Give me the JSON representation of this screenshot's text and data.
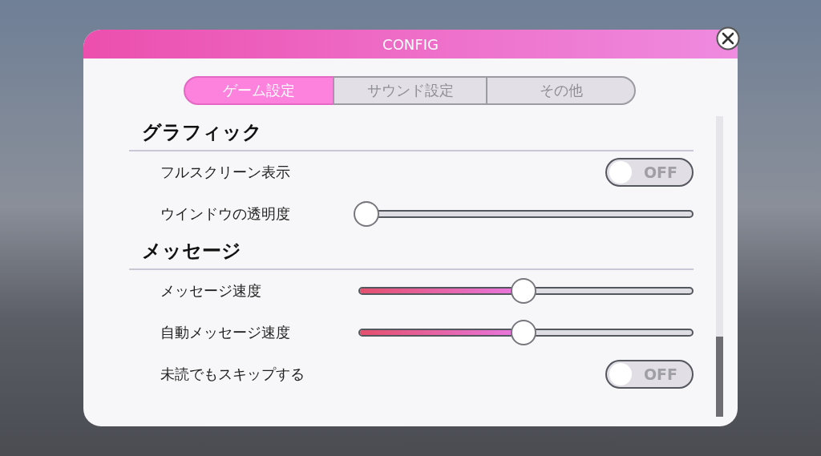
{
  "window": {
    "title": "CONFIG"
  },
  "tabs": [
    {
      "label": "ゲーム設定",
      "selected": true
    },
    {
      "label": "サウンド設定",
      "selected": false
    },
    {
      "label": "その他",
      "selected": false
    }
  ],
  "sections": [
    {
      "title": "グラフィック",
      "rows": [
        {
          "kind": "toggle",
          "label": "フルスクリーン表示",
          "on": false,
          "state_text": "OFF"
        },
        {
          "kind": "slider",
          "label": "ウインドウの透明度",
          "level": 0
        }
      ]
    },
    {
      "title": "メッセージ",
      "rows": [
        {
          "kind": "slider",
          "label": "メッセージ速度",
          "level": 0.5
        },
        {
          "kind": "slider",
          "label": "自動メッセージ速度",
          "level": 0.5
        },
        {
          "kind": "toggle",
          "label": "未読でもスキップする",
          "on": false,
          "state_text": "OFF"
        }
      ]
    }
  ]
}
